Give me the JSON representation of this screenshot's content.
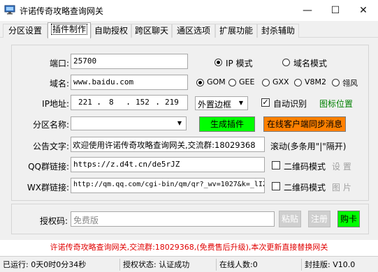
{
  "window": {
    "title": "许诺传奇攻略查询网关",
    "minimize": "—",
    "maximize": "☐",
    "close": "✕"
  },
  "tabs": [
    "分区设置",
    "插件制作",
    "自助授权",
    "跨区聊天",
    "通区选项",
    "扩展功能",
    "封杀辅助"
  ],
  "active_tab": "插件制作",
  "form": {
    "port_label": "端口:",
    "port_value": "25700",
    "mode_ip": "IP 模式",
    "mode_domain": "域名模式",
    "domain_label": "域名:",
    "domain_value": "www.baidu.com",
    "engines": [
      "GOM",
      "GEE",
      "GXX",
      "V8M2",
      "翎风"
    ],
    "ip_label": "IP地址:",
    "ip_parts": [
      "221",
      "8",
      "152",
      "219"
    ],
    "border_select": "外置边框",
    "auto_detect": "自动识别",
    "icon_position": "图标位置",
    "zone_label": "分区名称:",
    "generate_btn": "生成插件",
    "sync_btn": "在线客户端同步消息",
    "announce_label": "公告文字:",
    "announce_value": "欢迎使用许诺传奇攻略查询网关,交流群:18029368",
    "scroll_hint": "滚动(多条用\"|\"隔开)",
    "qq_label": "QQ群链接:",
    "qq_value": "https://z.d4t.cn/de5rJZ",
    "qr_mode_1": "二维码模式",
    "setup_btn": "设 置",
    "wx_label": "WX群链接:",
    "wx_value": "http://qm.qq.com/cgi-bin/qm/qr?_wv=1027&k=_lIZ",
    "qr_mode_2": "二维码模式",
    "image_btn": "图 片"
  },
  "auth": {
    "code_label": "授权码:",
    "code_placeholder": "免费版",
    "paste_btn": "粘贴",
    "register_btn": "注册",
    "buy_btn": "购卡"
  },
  "notice": "许诺传奇攻略查询网关,交流群:18029368,(免费售后升级),本次更新直接替换网关",
  "status": {
    "running": "已运行: 0天0时0分34秒",
    "auth_state": "授权状态: 认证成功",
    "online": "在线人数:0",
    "version": "封挂版: V10.0"
  },
  "colors": {
    "accent_green": "#00ff00",
    "accent_orange": "#ff8000",
    "notice_red": "#e00000",
    "link_green": "#008000"
  }
}
